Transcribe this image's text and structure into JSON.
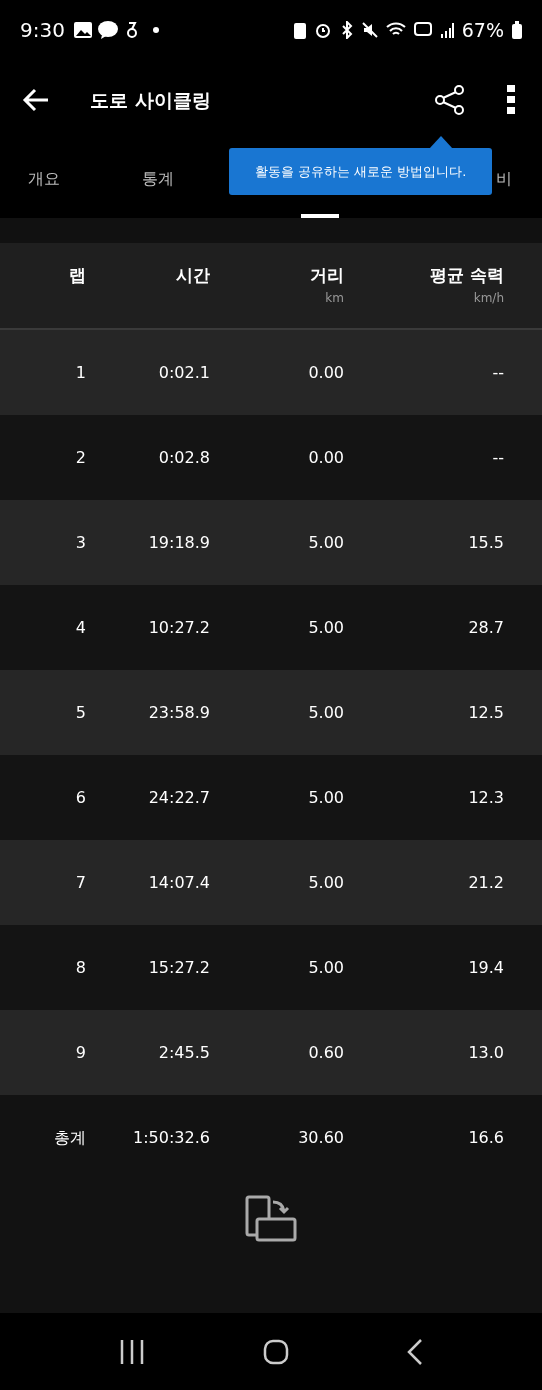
{
  "status_bar": {
    "time": "9:30",
    "battery": "67%"
  },
  "app_bar": {
    "title": "도로 사이클링"
  },
  "tabs": [
    {
      "label": "개요",
      "selected": false
    },
    {
      "label": "통계",
      "selected": false
    },
    {
      "selected": true
    },
    {
      "label": "비",
      "selected": false
    }
  ],
  "tooltip": {
    "text": "활동을 공유하는 새로운 방법입니다."
  },
  "table": {
    "columns": [
      {
        "label": "랩"
      },
      {
        "label": "시간"
      },
      {
        "label": "거리",
        "unit": "km"
      },
      {
        "label": "평균 속력",
        "unit": "km/h"
      }
    ],
    "rows": [
      [
        "1",
        "0:02.1",
        "0.00",
        "--"
      ],
      [
        "2",
        "0:02.8",
        "0.00",
        "--"
      ],
      [
        "3",
        "19:18.9",
        "5.00",
        "15.5"
      ],
      [
        "4",
        "10:27.2",
        "5.00",
        "28.7"
      ],
      [
        "5",
        "23:58.9",
        "5.00",
        "12.5"
      ],
      [
        "6",
        "24:22.7",
        "5.00",
        "12.3"
      ],
      [
        "7",
        "14:07.4",
        "5.00",
        "21.2"
      ],
      [
        "8",
        "15:27.2",
        "5.00",
        "19.4"
      ],
      [
        "9",
        "2:45.5",
        "0.60",
        "13.0"
      ]
    ],
    "total": [
      "총계",
      "1:50:32.6",
      "30.60",
      "16.6"
    ]
  }
}
